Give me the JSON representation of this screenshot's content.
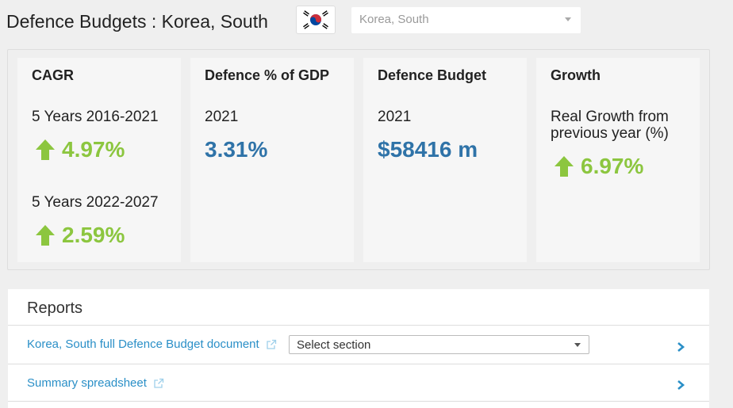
{
  "header": {
    "title": "Defence Budgets : Korea, South",
    "flag_icon": "south-korea-flag-icon",
    "country_select_value": "Korea, South"
  },
  "cards": {
    "cagr": {
      "title": "CAGR",
      "period1": "5 Years 2016-2021",
      "value1": "4.97%",
      "period2": "5 Years 2022-2027",
      "value2": "2.59%"
    },
    "gdp": {
      "title": "Defence % of GDP",
      "year": "2021",
      "value": "3.31%"
    },
    "budget": {
      "title": "Defence Budget",
      "year": "2021",
      "value": "$58416 m"
    },
    "growth": {
      "title": "Growth",
      "subtitle": "Real Growth from previous year (%)",
      "value": "6.97%"
    }
  },
  "reports": {
    "title": "Reports",
    "items": [
      {
        "label": "Korea, South full Defence Budget document",
        "select_value": "Select section"
      },
      {
        "label": "Summary spreadsheet"
      }
    ]
  },
  "colors": {
    "positive": "#8cc63f",
    "value_blue": "#2f73a8",
    "link": "#2a8fc7"
  }
}
